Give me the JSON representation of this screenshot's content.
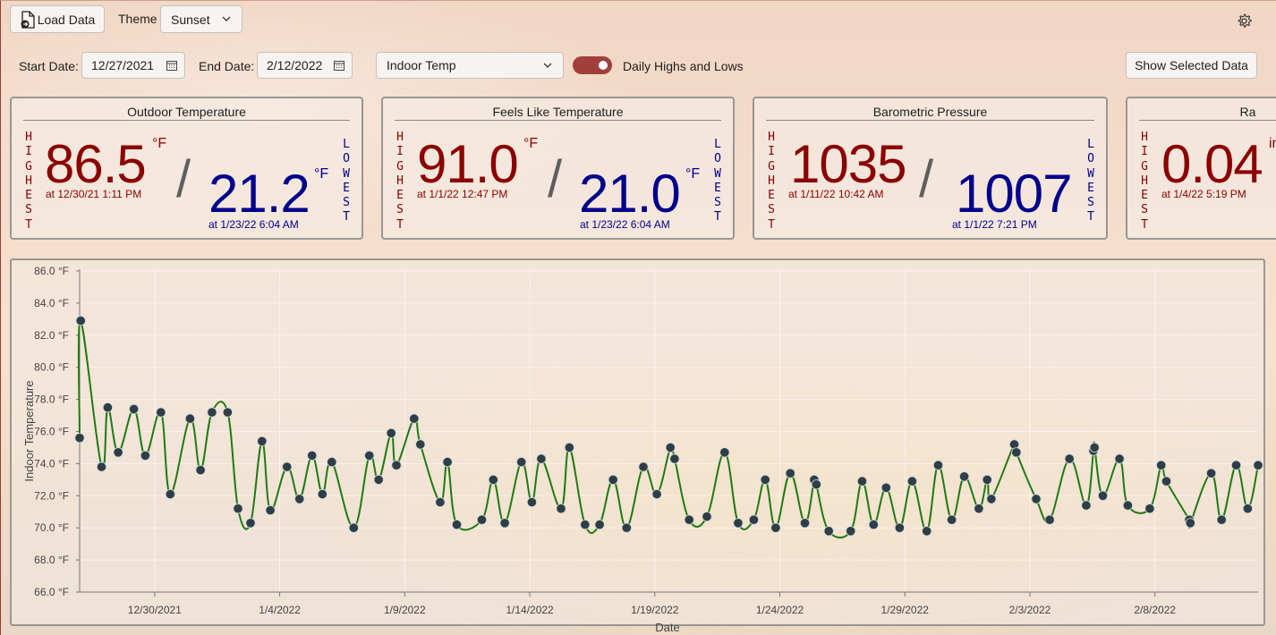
{
  "toolbar": {
    "load_label": "Load Data",
    "theme_label": "Theme",
    "theme_value": "Sunset"
  },
  "filters": {
    "start_label": "Start Date:",
    "start_value": "12/27/2021",
    "end_label": "End Date:",
    "end_value": "2/12/2022",
    "metric_value": "Indoor Temp",
    "toggle_label": "Daily Highs and Lows",
    "toggle_on": true,
    "show_label": "Show Selected Data"
  },
  "colors": {
    "high": "#8b0000",
    "low": "#00008b",
    "line": "#1f7a12",
    "marker": "#2f3e46",
    "toggle": "#a0403c"
  },
  "icons": [
    "load-data-icon",
    "gear-icon",
    "calendar-icon",
    "chevron-down-icon"
  ],
  "cards": [
    {
      "title": "Outdoor Temperature",
      "high_word": "HIGHEST",
      "low_word": "LOWEST",
      "high": "86.5",
      "high_unit": "°F",
      "high_at": "at 12/30/21 1:11 PM",
      "low": "21.2",
      "low_unit": "°F",
      "low_at": "at 1/23/22 6:04 AM"
    },
    {
      "title": "Feels Like Temperature",
      "high_word": "HIGHEST",
      "low_word": "LOWEST",
      "high": "91.0",
      "high_unit": "°F",
      "high_at": "at 1/1/22 12:47 PM",
      "low": "21.0",
      "low_unit": "°F",
      "low_at": "at 1/23/22 6:04 AM"
    },
    {
      "title": "Barometric Pressure",
      "high_word": "HIGHEST",
      "low_word": "LOWEST",
      "high": "1035",
      "high_unit": "",
      "high_at": "at 1/11/22 10:42 AM",
      "low": "1007",
      "low_unit": "",
      "low_at": "at 1/1/22 7:21 PM"
    },
    {
      "title": "Ra",
      "high_word": "HIGHEST",
      "high": "0.04",
      "high_unit": "in",
      "high_at": "at 1/4/22 5:19 PM"
    }
  ],
  "chart_data": {
    "type": "line",
    "xlabel": "Date",
    "ylabel": "Indoor Temperature",
    "ylim": [
      66,
      86
    ],
    "xlim": [
      "12/27/2021",
      "2/12/2022"
    ],
    "yticks": [
      "66.0 °F",
      "68.0 °F",
      "70.0 °F",
      "72.0 °F",
      "74.0 °F",
      "76.0 °F",
      "78.0 °F",
      "80.0 °F",
      "82.0 °F",
      "84.0 °F",
      "86.0 °F"
    ],
    "yticks_values": [
      66,
      68,
      70,
      72,
      74,
      76,
      78,
      80,
      82,
      84,
      86
    ],
    "xticks": [
      "12/30/2021",
      "1/4/2022",
      "1/9/2022",
      "1/14/2022",
      "1/19/2022",
      "1/24/2022",
      "1/29/2022",
      "2/3/2022",
      "2/8/2022"
    ],
    "grid": true,
    "points": [
      {
        "x": "2021-12-27 00:00",
        "y": 75.6
      },
      {
        "x": "2021-12-27 01:00",
        "y": 82.9
      },
      {
        "x": "2021-12-27 21:00",
        "y": 73.8
      },
      {
        "x": "2021-12-28 03:00",
        "y": 77.5
      },
      {
        "x": "2021-12-28 13:00",
        "y": 74.7
      },
      {
        "x": "2021-12-29 04:00",
        "y": 77.4
      },
      {
        "x": "2021-12-29 15:00",
        "y": 74.5
      },
      {
        "x": "2021-12-30 06:00",
        "y": 77.2
      },
      {
        "x": "2021-12-30 15:00",
        "y": 72.1
      },
      {
        "x": "2021-12-31 10:00",
        "y": 76.8
      },
      {
        "x": "2021-12-31 20:00",
        "y": 73.6
      },
      {
        "x": "2022-01-01 07:00",
        "y": 77.2
      },
      {
        "x": "2022-01-01 22:00",
        "y": 77.2
      },
      {
        "x": "2022-01-02 08:00",
        "y": 71.2
      },
      {
        "x": "2022-01-02 20:00",
        "y": 70.3
      },
      {
        "x": "2022-01-03 07:00",
        "y": 75.4
      },
      {
        "x": "2022-01-03 15:00",
        "y": 71.1
      },
      {
        "x": "2022-01-04 07:00",
        "y": 73.8
      },
      {
        "x": "2022-01-04 19:00",
        "y": 71.8
      },
      {
        "x": "2022-01-05 07:00",
        "y": 74.5
      },
      {
        "x": "2022-01-05 17:00",
        "y": 72.1
      },
      {
        "x": "2022-01-06 02:00",
        "y": 74.1
      },
      {
        "x": "2022-01-06 23:00",
        "y": 70.0
      },
      {
        "x": "2022-01-07 14:00",
        "y": 74.5
      },
      {
        "x": "2022-01-07 23:00",
        "y": 73.0
      },
      {
        "x": "2022-01-08 11:00",
        "y": 75.9
      },
      {
        "x": "2022-01-08 16:00",
        "y": 73.9
      },
      {
        "x": "2022-01-09 09:00",
        "y": 76.8
      },
      {
        "x": "2022-01-09 15:00",
        "y": 75.2
      },
      {
        "x": "2022-01-10 10:00",
        "y": 71.6
      },
      {
        "x": "2022-01-10 17:00",
        "y": 74.1
      },
      {
        "x": "2022-01-11 02:00",
        "y": 70.2
      },
      {
        "x": "2022-01-12 02:00",
        "y": 70.5
      },
      {
        "x": "2022-01-12 13:00",
        "y": 73.0
      },
      {
        "x": "2022-01-13 00:00",
        "y": 70.3
      },
      {
        "x": "2022-01-13 16:00",
        "y": 74.1
      },
      {
        "x": "2022-01-14 02:00",
        "y": 71.6
      },
      {
        "x": "2022-01-14 11:00",
        "y": 74.3
      },
      {
        "x": "2022-01-15 06:00",
        "y": 71.2
      },
      {
        "x": "2022-01-15 14:00",
        "y": 75.0
      },
      {
        "x": "2022-01-16 05:00",
        "y": 70.2
      },
      {
        "x": "2022-01-16 19:00",
        "y": 70.2
      },
      {
        "x": "2022-01-17 08:00",
        "y": 73.0
      },
      {
        "x": "2022-01-17 21:00",
        "y": 70.0
      },
      {
        "x": "2022-01-18 13:00",
        "y": 73.8
      },
      {
        "x": "2022-01-19 02:00",
        "y": 72.1
      },
      {
        "x": "2022-01-19 15:00",
        "y": 75.0
      },
      {
        "x": "2022-01-19 19:00",
        "y": 74.3
      },
      {
        "x": "2022-01-20 09:00",
        "y": 70.5
      },
      {
        "x": "2022-01-21 02:00",
        "y": 70.7
      },
      {
        "x": "2022-01-21 19:00",
        "y": 74.7
      },
      {
        "x": "2022-01-22 08:00",
        "y": 70.3
      },
      {
        "x": "2022-01-22 23:00",
        "y": 70.5
      },
      {
        "x": "2022-01-23 10:00",
        "y": 73.0
      },
      {
        "x": "2022-01-23 20:00",
        "y": 70.0
      },
      {
        "x": "2022-01-24 10:00",
        "y": 73.4
      },
      {
        "x": "2022-01-25 00:00",
        "y": 70.3
      },
      {
        "x": "2022-01-25 09:00",
        "y": 73.0
      },
      {
        "x": "2022-01-25 11:00",
        "y": 72.7
      },
      {
        "x": "2022-01-25 23:00",
        "y": 69.8
      },
      {
        "x": "2022-01-26 20:00",
        "y": 69.8
      },
      {
        "x": "2022-01-27 07:00",
        "y": 72.9
      },
      {
        "x": "2022-01-27 18:00",
        "y": 70.2
      },
      {
        "x": "2022-01-28 06:00",
        "y": 72.5
      },
      {
        "x": "2022-01-28 19:00",
        "y": 70.0
      },
      {
        "x": "2022-01-29 07:00",
        "y": 72.9
      },
      {
        "x": "2022-01-29 21:00",
        "y": 69.8
      },
      {
        "x": "2022-01-30 08:00",
        "y": 73.9
      },
      {
        "x": "2022-01-30 21:00",
        "y": 70.5
      },
      {
        "x": "2022-01-31 09:00",
        "y": 73.2
      },
      {
        "x": "2022-01-31 23:00",
        "y": 71.2
      },
      {
        "x": "2022-02-01 07:00",
        "y": 73.0
      },
      {
        "x": "2022-02-01 11:00",
        "y": 71.8
      },
      {
        "x": "2022-02-02 09:00",
        "y": 75.2
      },
      {
        "x": "2022-02-02 11:00",
        "y": 74.7
      },
      {
        "x": "2022-02-03 06:00",
        "y": 71.8
      },
      {
        "x": "2022-02-03 19:00",
        "y": 70.5
      },
      {
        "x": "2022-02-04 14:00",
        "y": 74.3
      },
      {
        "x": "2022-02-05 06:00",
        "y": 71.4
      },
      {
        "x": "2022-02-05 13:00",
        "y": 74.8
      },
      {
        "x": "2022-02-05 14:00",
        "y": 75.0
      },
      {
        "x": "2022-02-05 22:00",
        "y": 72.0
      },
      {
        "x": "2022-02-06 14:00",
        "y": 74.3
      },
      {
        "x": "2022-02-06 22:00",
        "y": 71.4
      },
      {
        "x": "2022-02-07 19:00",
        "y": 71.2
      },
      {
        "x": "2022-02-08 06:00",
        "y": 73.9
      },
      {
        "x": "2022-02-08 11:00",
        "y": 72.9
      },
      {
        "x": "2022-02-09 09:00",
        "y": 70.5
      },
      {
        "x": "2022-02-09 10:00",
        "y": 70.3
      },
      {
        "x": "2022-02-10 06:00",
        "y": 73.4
      },
      {
        "x": "2022-02-10 16:00",
        "y": 70.5
      },
      {
        "x": "2022-02-11 06:00",
        "y": 73.9
      },
      {
        "x": "2022-02-11 17:00",
        "y": 71.2
      },
      {
        "x": "2022-02-12 03:00",
        "y": 73.9
      }
    ]
  }
}
